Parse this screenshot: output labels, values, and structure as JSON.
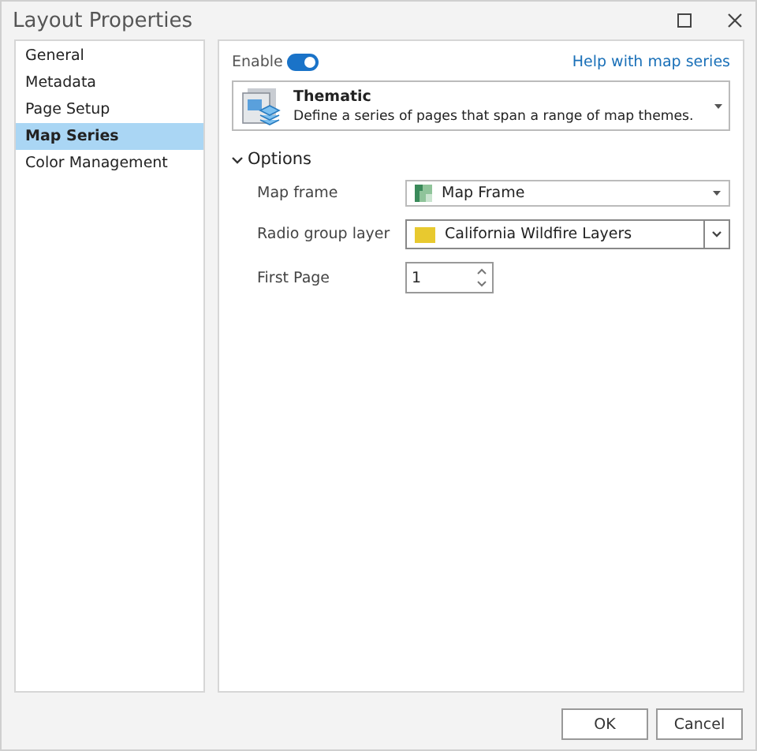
{
  "window": {
    "title": "Layout Properties"
  },
  "sidebar": {
    "items": [
      {
        "label": "General",
        "selected": false
      },
      {
        "label": "Metadata",
        "selected": false
      },
      {
        "label": "Page Setup",
        "selected": false
      },
      {
        "label": "Map Series",
        "selected": true
      },
      {
        "label": "Color Management",
        "selected": false
      }
    ]
  },
  "enable": {
    "label": "Enable",
    "on": true
  },
  "help_link": "Help with map series",
  "series_type": {
    "title": "Thematic",
    "description": "Define a series of pages that span a range of map themes."
  },
  "options": {
    "label": "Options",
    "expanded": true,
    "fields": [
      {
        "kind": "dropdown",
        "label": "Map frame",
        "value": "Map Frame"
      },
      {
        "kind": "combo",
        "label": "Radio group layer",
        "value": "California Wildfire Layers"
      },
      {
        "kind": "spinner",
        "label": "First Page",
        "value": "1"
      }
    ]
  },
  "buttons": [
    "OK",
    "Cancel"
  ]
}
